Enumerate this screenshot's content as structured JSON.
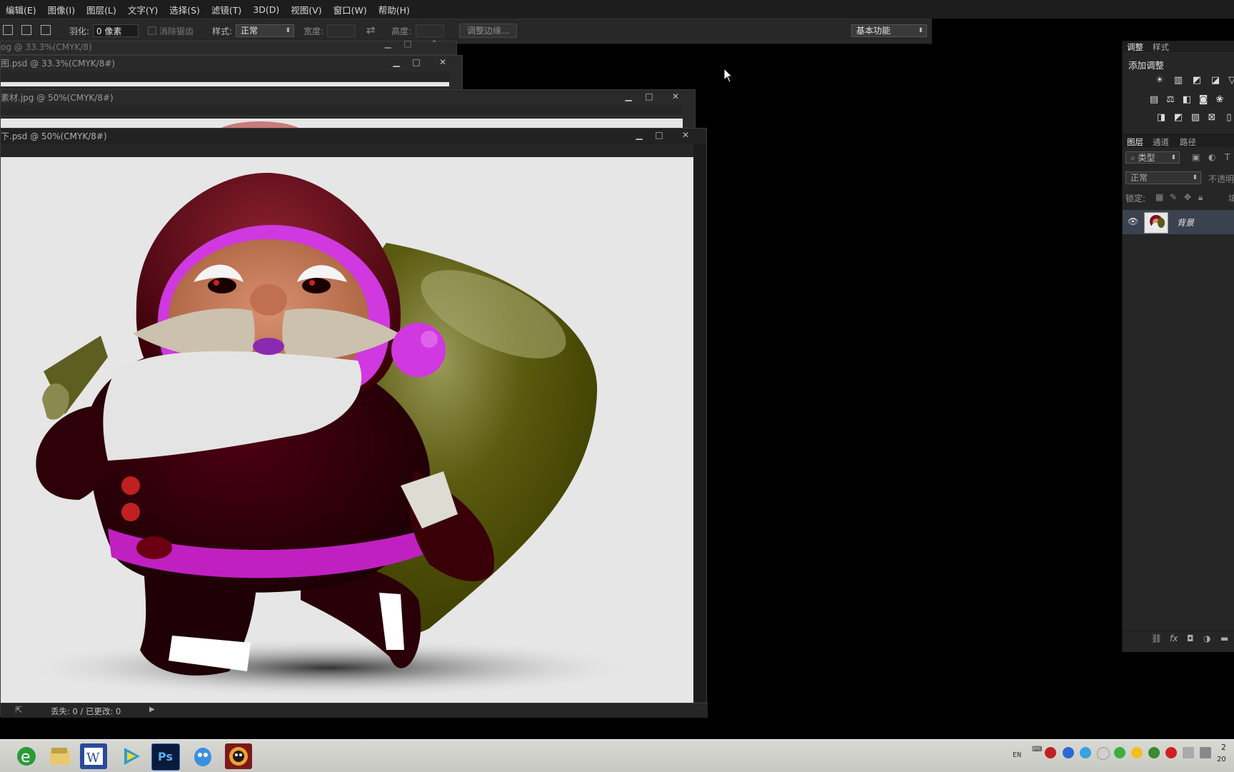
{
  "menu": [
    "编辑(E)",
    "图像(I)",
    "图层(L)",
    "文字(Y)",
    "选择(S)",
    "滤镜(T)",
    "3D(D)",
    "视图(V)",
    "窗口(W)",
    "帮助(H)"
  ],
  "options": {
    "feather_label": "羽化:",
    "feather_value": "0 像素",
    "antialias_label": "消除锯齿",
    "style_label": "样式:",
    "style_value": "正常",
    "width_label": "宽度:",
    "height_label": "高度:",
    "refine_edge_button": "调整边缘...",
    "workspace_value": "基本功能"
  },
  "documents": {
    "doc1_title": "og @ 33.3%(CMYK/8)",
    "doc2_title": "图.psd @ 33.3%(CMYK/8#)",
    "doc3_title": "素材.jpg @ 50%(CMYK/8#)",
    "doc4_title": "下.psd @ 50%(CMYK/8#)"
  },
  "status": {
    "text": "丢失: 0 / 已更改: 0"
  },
  "adjust_panel": {
    "tab_adjust": "调整",
    "tab_style": "样式",
    "header": "添加调整",
    "icons": [
      "brightness-contrast-icon",
      "levels-icon",
      "curves-icon",
      "exposure-icon",
      "vibrance-icon",
      "hue-saturation-icon",
      "color-balance-icon",
      "black-white-icon",
      "photo-filter-icon",
      "channel-mixer-icon",
      "invert-icon",
      "posterize-icon",
      "threshold-icon",
      "selective-color-icon",
      "gradient-map-icon"
    ]
  },
  "layers_panel": {
    "tab_layers": "图层",
    "tab_channels": "通道",
    "tab_paths": "路径",
    "filter_label": "类型",
    "blend_mode": "正常",
    "opacity_label": "不透明",
    "lock_label": "锁定:",
    "fill_label": "填",
    "layer_name": "背景"
  },
  "taskbar": {
    "apps": [
      "ie-icon",
      "explorer-icon",
      "word-icon",
      "media-player-icon",
      "photoshop-icon",
      "qq-icon",
      "app-icon"
    ],
    "ps_label": "Ps",
    "lang": "EN",
    "clock_line1": "2",
    "clock_line2": "20"
  },
  "colors": {
    "canvas_bg": "#e6e6e6",
    "panel_bg": "#262626",
    "taskbar_bg": "#d0d0cc"
  }
}
